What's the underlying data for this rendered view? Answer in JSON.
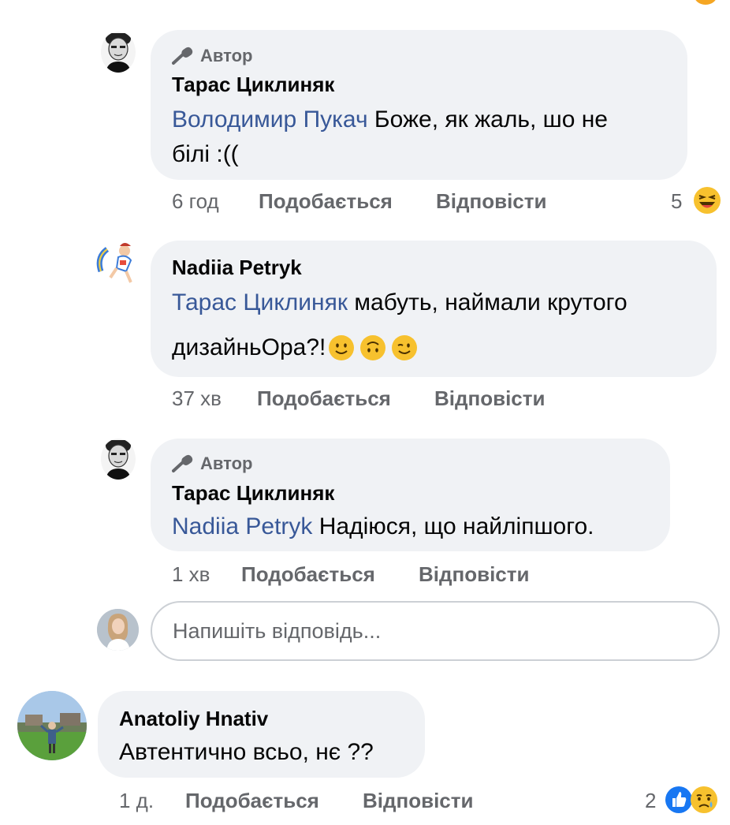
{
  "comments": [
    {
      "author_badge": "Автор",
      "name": "Тарас Циклиняк",
      "mention": "Володимир Пукач",
      "text": " Боже, як жаль, шо не",
      "text2": "білі :((",
      "time": "6 год",
      "like_label": "Подобається",
      "reply_label": "Відповісти",
      "reaction_count": "5",
      "reaction_icon": "laughing-emoji-icon"
    },
    {
      "name": "Nadiia Petryk",
      "mention": "Тарас Циклиняк",
      "text": " мабуть, наймали крутого",
      "text2": "дизайньОра?!",
      "inline_emojis": [
        "slightly-smiling-emoji-icon",
        "upside-down-emoji-icon",
        "winking-emoji-icon"
      ],
      "time": "37 хв",
      "like_label": "Подобається",
      "reply_label": "Відповісти"
    },
    {
      "author_badge": "Автор",
      "name": "Тарас Циклиняк",
      "mention": "Nadiia Petryk",
      "text": " Надіюся, що найліпшого.",
      "time": "1 хв",
      "like_label": "Подобається",
      "reply_label": "Відповісти"
    },
    {
      "name": "Anatoliy Hnativ",
      "text": "Автентично всьо, нє ??",
      "time": "1 д.",
      "like_label": "Подобається",
      "reply_label": "Відповісти",
      "reaction_count": "2",
      "reaction_icons": [
        "like-icon",
        "sad-emoji-icon"
      ]
    }
  ],
  "reply": {
    "placeholder": "Напишіть відповідь..."
  },
  "colors": {
    "bubble": "#f0f2f5",
    "mention": "#385898",
    "meta": "#65676b",
    "like_blue": "#1877f2",
    "emoji_yellow": "#f7c12e"
  }
}
